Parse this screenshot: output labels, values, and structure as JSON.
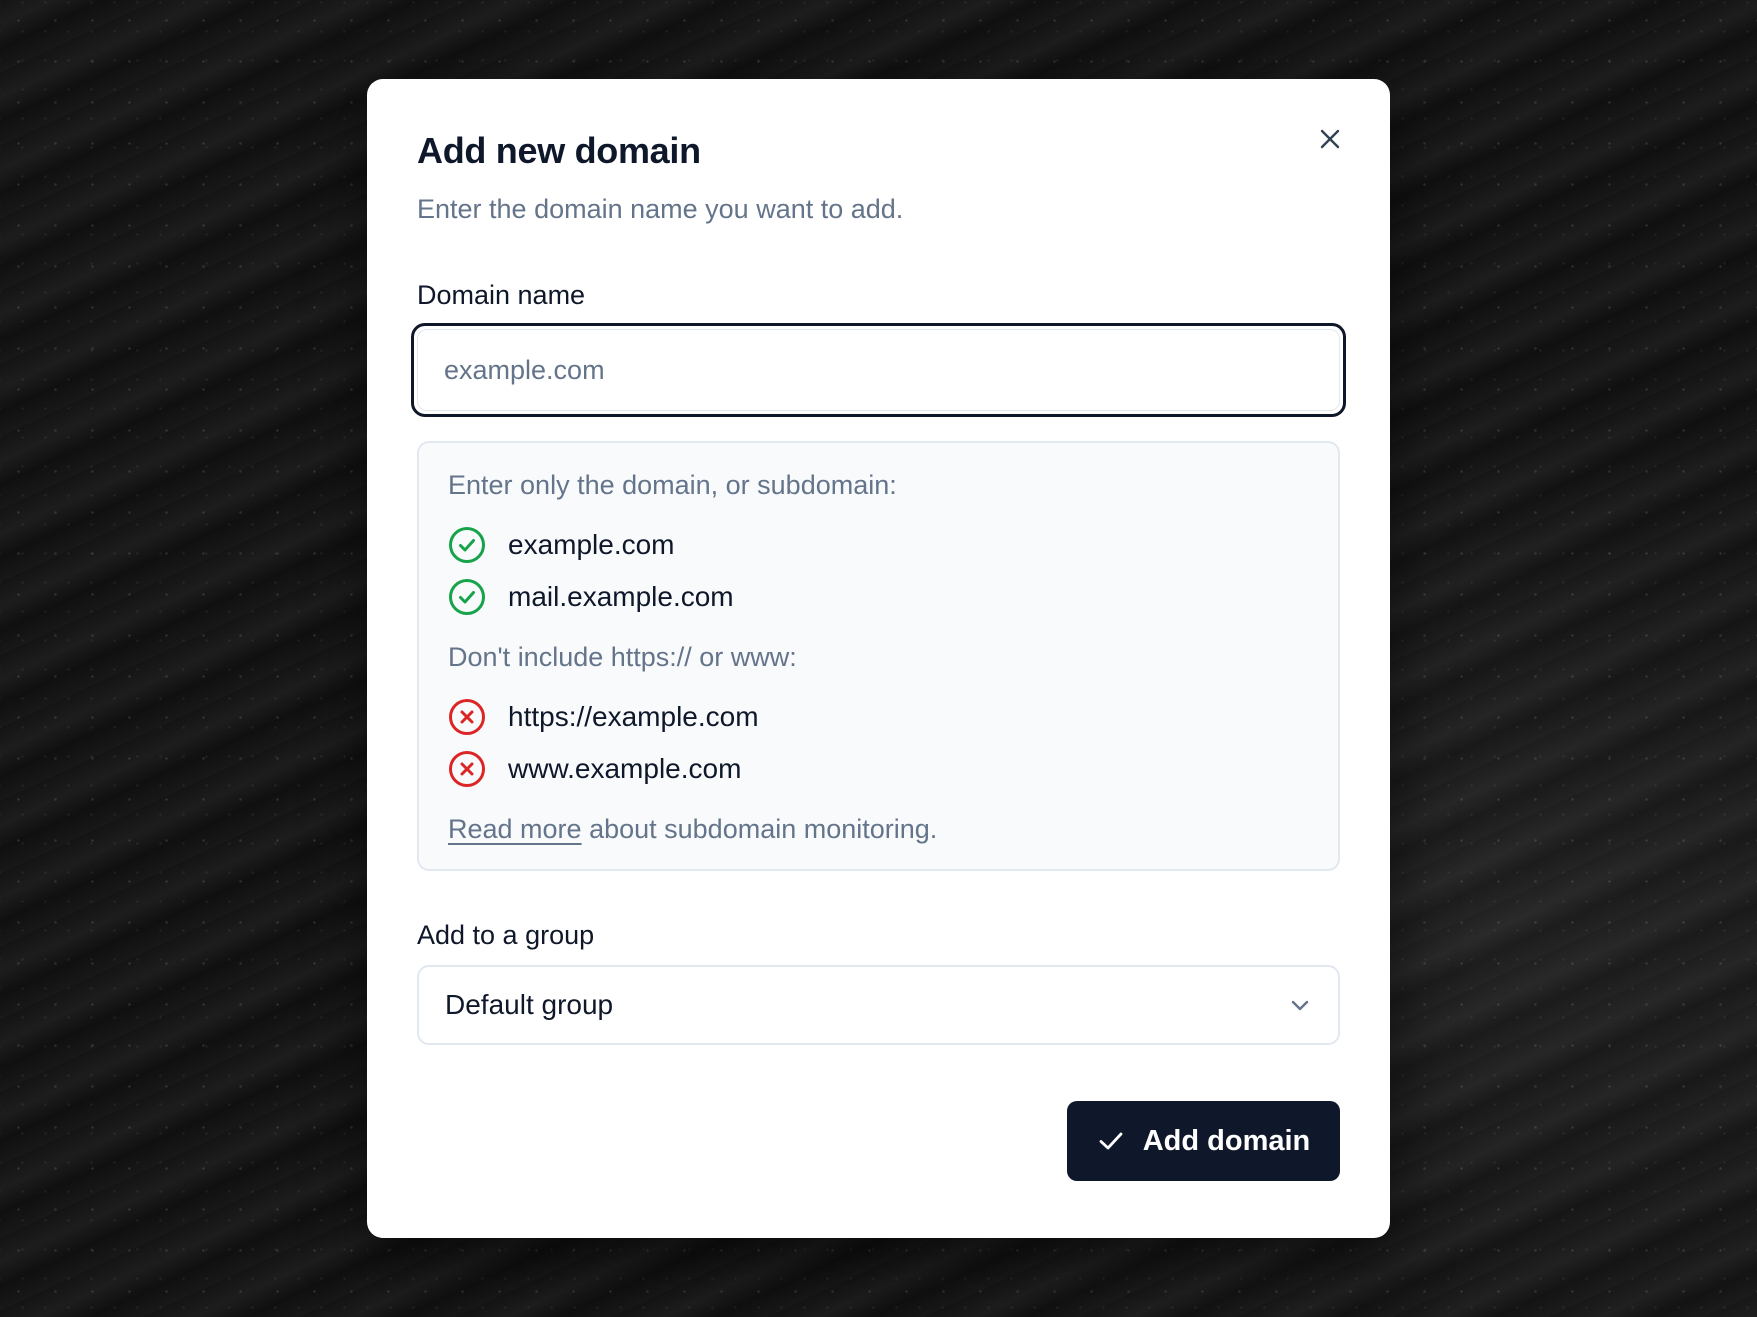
{
  "dialog": {
    "title": "Add new domain",
    "subtitle": "Enter the domain name you want to add.",
    "close_icon": "close-icon"
  },
  "domain_field": {
    "label": "Domain name",
    "value": "",
    "placeholder": "example.com"
  },
  "hints": {
    "allowed_heading": "Enter only the domain, or subdomain:",
    "allowed": [
      {
        "text": "example.com",
        "icon": "check-circle-icon"
      },
      {
        "text": "mail.example.com",
        "icon": "check-circle-icon"
      }
    ],
    "disallowed_heading": "Don't include https:// or www:",
    "disallowed": [
      {
        "text": "https://example.com",
        "icon": "x-circle-icon"
      },
      {
        "text": "www.example.com",
        "icon": "x-circle-icon"
      }
    ],
    "read_more_link": "Read more",
    "read_more_suffix": " about subdomain monitoring."
  },
  "group_field": {
    "label": "Add to a group",
    "selected": "Default group",
    "icon": "chevron-down-icon"
  },
  "submit": {
    "label": "Add domain",
    "icon": "check-icon"
  },
  "colors": {
    "primary": "#0f172a",
    "muted": "#64748b",
    "success": "#16a34a",
    "error": "#dc2626",
    "border": "#e2e8f0",
    "hint_bg": "#f8fafc"
  }
}
